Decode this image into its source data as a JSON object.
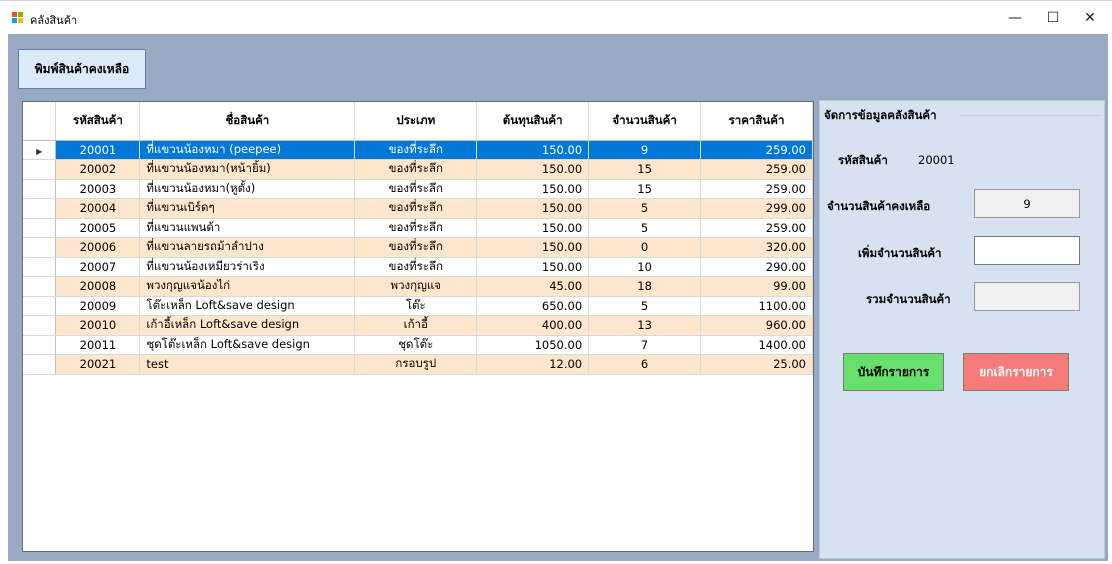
{
  "window": {
    "title": "คลังสินค้า",
    "minimize": "—",
    "maximize": "☐",
    "close": "✕"
  },
  "toolbar": {
    "print_label": "พิมพ์สินค้าคงเหลือ"
  },
  "table": {
    "columns": [
      "รหัสสินค้า",
      "ชื่อสินค้า",
      "ประเภท",
      "ต้นทุนสินค้า",
      "จำนวนสินค้า",
      "ราคาสินค้า"
    ],
    "rows": [
      [
        "20001",
        "ที่แขวนน้องหมา (peepee)",
        "ของที่ระลึก",
        "150.00",
        "9",
        "259.00"
      ],
      [
        "20002",
        "ที่แขวนน้องหมา(หน้ายิ้ม)",
        "ของที่ระลึก",
        "150.00",
        "15",
        "259.00"
      ],
      [
        "20003",
        "ที่แขวนน้องหมา(หูตั้ง)",
        "ของที่ระลึก",
        "150.00",
        "15",
        "259.00"
      ],
      [
        "20004",
        "ที่แขวนเบิร์ดๆ",
        "ของที่ระลึก",
        "150.00",
        "5",
        "299.00"
      ],
      [
        "20005",
        "ที่แขวนแพนด้า",
        "ของที่ระลึก",
        "150.00",
        "5",
        "259.00"
      ],
      [
        "20006",
        "ที่แขวนลายรถม้าลำปาง",
        "ของที่ระลึก",
        "150.00",
        "0",
        "320.00"
      ],
      [
        "20007",
        "ที่แขวนน้องเหมียวร่าเริง",
        "ของที่ระลึก",
        "150.00",
        "10",
        "290.00"
      ],
      [
        "20008",
        "พวงกุญแจน้องไก่",
        "พวงกุญแจ",
        "45.00",
        "18",
        "99.00"
      ],
      [
        "20009",
        "โต๊ะเหล็ก Loft&save design",
        "โต๊ะ",
        "650.00",
        "5",
        "1100.00"
      ],
      [
        "20010",
        "เก้าอี้เหล็ก Loft&save design",
        "เก้าอี้",
        "400.00",
        "13",
        "960.00"
      ],
      [
        "20011",
        "ชุดโต๊ะเหล็ก Loft&save design",
        "ชุดโต๊ะ",
        "1050.00",
        "7",
        "1400.00"
      ],
      [
        "20021",
        "test",
        "กรอบรูป",
        "12.00",
        "6",
        "25.00"
      ]
    ],
    "selected_index": 0,
    "row_indicator": "▶"
  },
  "panel": {
    "title": "จัดการข้อมูลคลังสินค้า",
    "code_label": "รหัสสินค้า",
    "code_value": "20001",
    "remaining_label": "จำนวนสินค้าคงเหลือ",
    "remaining_value": "9",
    "add_label": "เพิ่มจำนวนสินค้า",
    "add_value": "",
    "total_label": "รวมจำนวนสินค้า",
    "total_value": "",
    "save_label": "บันทึกรายการ",
    "cancel_label": "ยกเลิกรายการ"
  },
  "colors": {
    "client_bg": "#98a9c4",
    "selected_row": "#0078d7",
    "alt_row": "#fde6cc",
    "save_button": "#66e06a",
    "cancel_button": "#f77a7a"
  }
}
